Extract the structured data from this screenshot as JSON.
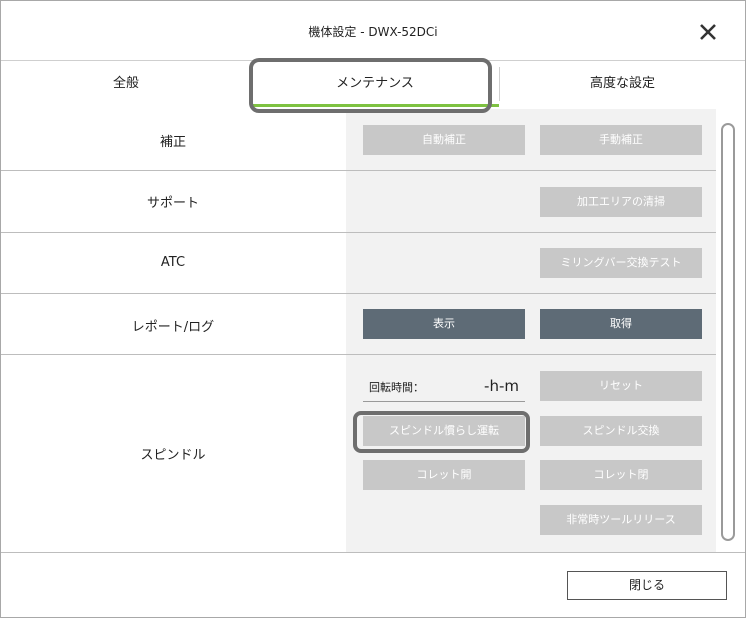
{
  "window": {
    "title": "機体設定 - DWX-52DCi"
  },
  "tabs": [
    {
      "label": "全般"
    },
    {
      "label": "メンテナンス"
    },
    {
      "label": "高度な設定"
    }
  ],
  "sections": {
    "calibration": {
      "label": "補正",
      "auto_button": "自動補正",
      "manual_button": "手動補正"
    },
    "support": {
      "label": "サポート",
      "clean_button": "加工エリアの清掃"
    },
    "atc": {
      "label": "ATC",
      "milling_bar_button": "ミリングバー交換テスト"
    },
    "report": {
      "label": "レポート/ログ",
      "show_button": "表示",
      "get_button": "取得"
    },
    "spindle": {
      "label": "スピンドル",
      "runtime_label": "回転時間：",
      "runtime_value": "-h-m",
      "reset_button": "リセット",
      "breakin_button": "スピンドル慣らし運転",
      "replace_button": "スピンドル交換",
      "collet_open_button": "コレット開",
      "collet_close_button": "コレット閉",
      "emergency_release_button": "非常時ツールリリース"
    }
  },
  "footer": {
    "close_button": "閉じる"
  },
  "colors": {
    "accent_green": "#7ec241",
    "dark_button": "#5e6b76",
    "disabled_button": "#c8c8c8",
    "callout": "#6e6e6e"
  }
}
